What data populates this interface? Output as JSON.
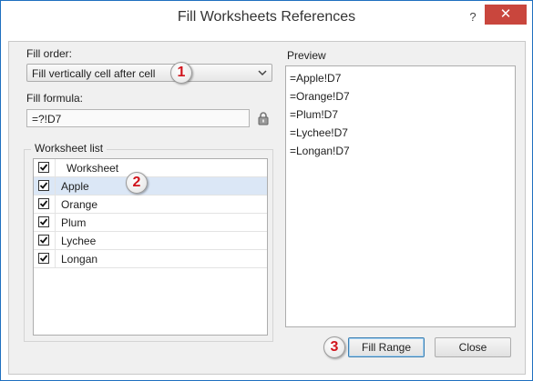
{
  "window": {
    "title": "Fill Worksheets References",
    "help_label": "?",
    "close_label": "✕"
  },
  "fill_order": {
    "label": "Fill order:",
    "selected": "Fill vertically cell after cell"
  },
  "fill_formula": {
    "label": "Fill formula:",
    "value": "=?!D7"
  },
  "worksheet_list": {
    "group_label": "Worksheet list",
    "header": "Worksheet",
    "header_checked": true,
    "items": [
      {
        "name": "Apple",
        "checked": true,
        "selected": true
      },
      {
        "name": "Orange",
        "checked": true,
        "selected": false
      },
      {
        "name": "Plum",
        "checked": true,
        "selected": false
      },
      {
        "name": "Lychee",
        "checked": true,
        "selected": false
      },
      {
        "name": "Longan",
        "checked": true,
        "selected": false
      }
    ]
  },
  "preview": {
    "label": "Preview",
    "lines": [
      "=Apple!D7",
      "=Orange!D7",
      "=Plum!D7",
      "=Lychee!D7",
      "=Longan!D7"
    ]
  },
  "buttons": {
    "fill_range": "Fill Range",
    "close": "Close"
  },
  "badges": [
    "1",
    "2",
    "3"
  ],
  "colors": {
    "close_button": "#c9463d",
    "selected_row": "#dbe7f6",
    "badge_text": "#d0141c"
  }
}
